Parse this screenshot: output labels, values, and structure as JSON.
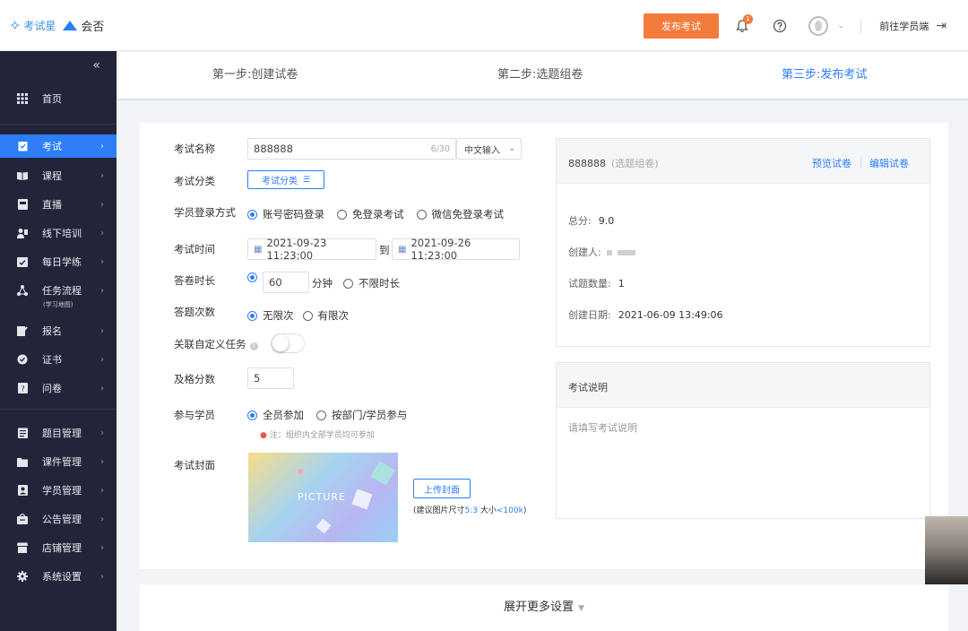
{
  "header": {
    "brand_name": "考试星",
    "brand_partner": "会否",
    "publish_label": "发布考试",
    "notification_count": "1",
    "student_link_label": "前往学员端"
  },
  "sidebar": {
    "home_label": "首页",
    "items": [
      {
        "label": "考试",
        "icon": "exam-icon",
        "active": true
      },
      {
        "label": "课程",
        "icon": "book-icon"
      },
      {
        "label": "直播",
        "icon": "live-icon"
      },
      {
        "label": "线下培训",
        "icon": "training-icon"
      },
      {
        "label": "每日学练",
        "icon": "daily-practice-icon"
      },
      {
        "label": "任务流程",
        "icon": "task-flow-icon",
        "sub": "(学习地图)"
      },
      {
        "label": "报名",
        "icon": "signup-icon"
      },
      {
        "label": "证书",
        "icon": "certificate-icon"
      },
      {
        "label": "问卷",
        "icon": "survey-icon"
      },
      {
        "label": "题目管理",
        "icon": "question-bank-icon"
      },
      {
        "label": "课件管理",
        "icon": "folder-icon"
      },
      {
        "label": "学员管理",
        "icon": "user-icon"
      },
      {
        "label": "公告管理",
        "icon": "announcement-icon"
      },
      {
        "label": "店铺管理",
        "icon": "store-icon"
      },
      {
        "label": "系统设置",
        "icon": "gear-icon"
      }
    ]
  },
  "steps": [
    {
      "label": "第一步:创建试卷"
    },
    {
      "label": "第二步:选题组卷"
    },
    {
      "label": "第三步:发布考试",
      "current": true
    }
  ],
  "form": {
    "name_label": "考试名称",
    "name_value": "888888",
    "name_count": "6/30",
    "ime_label": "中文输入",
    "category_label": "考试分类",
    "category_button": "考试分类",
    "login_label": "学员登录方式",
    "login_options": [
      "账号密码登录",
      "免登录考试",
      "微信免登录考试"
    ],
    "time_label": "考试时间",
    "time_start": "2021-09-23 11:23:00",
    "time_to": "到",
    "time_end": "2021-09-26 11:23:00",
    "duration_label": "答卷时长",
    "duration_value": "60",
    "duration_unit": "分钟",
    "duration_unlimited": "不限时长",
    "attempts_label": "答题次数",
    "attempts_options": [
      "无限次",
      "有限次"
    ],
    "custom_task_label": "关联自定义任务",
    "pass_label": "及格分数",
    "pass_value": "5",
    "participants_label": "参与学员",
    "participants_options": [
      "全员参加",
      "按部门/学员参与"
    ],
    "participants_note": "注：组织内全部学员均可参加",
    "cover_label": "考试封面",
    "cover_text": "PICTURE",
    "upload_label": "上传封面",
    "upload_tip_prefix": "(建议图片尺寸",
    "upload_tip_ratio": "5:3",
    "upload_tip_mid": " 大小",
    "upload_tip_size": "<100k",
    "upload_tip_suffix": ")"
  },
  "summary": {
    "title": "888888",
    "subtitle": "(选题组卷)",
    "preview_link": "预览试卷",
    "edit_link": "编辑试卷",
    "total_label": "总分:",
    "total_value": "9.0",
    "creator_label": "创建人:",
    "count_label": "试题数量:",
    "count_value": "1",
    "date_label": "创建日期:",
    "date_value": "2021-06-09 13:49:06"
  },
  "description": {
    "title": "考试说明",
    "placeholder": "请填写考试说明"
  },
  "more_settings": "展开更多设置",
  "colors": {
    "accent": "#2d7ef7",
    "publish": "#f37b3c",
    "sidebar_bg": "#22253a"
  }
}
